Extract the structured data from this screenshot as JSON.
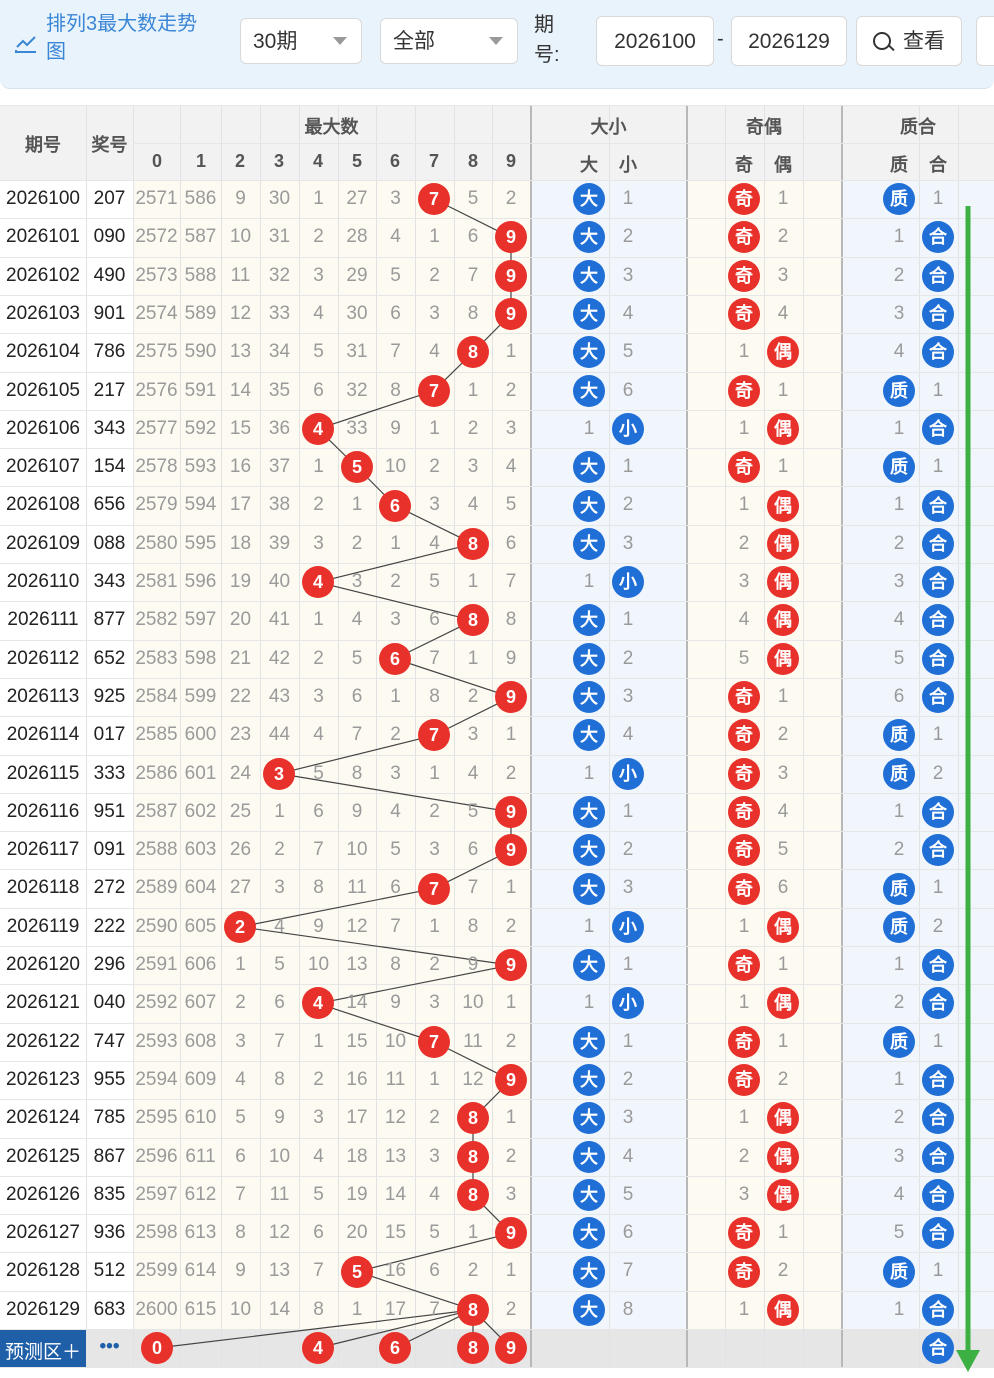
{
  "toolbar": {
    "title": "排列3最大数走势图",
    "period_select": "30期",
    "type_select": "全部",
    "period_label": "期号:",
    "from": "2026100",
    "dash": "-",
    "to": "2026129",
    "query": "查看"
  },
  "headers": {
    "period": "期号",
    "award": "奖号",
    "max_group": "最大数",
    "size_group": "大小",
    "odd_group": "奇偶",
    "prime_group": "质合",
    "digits": [
      "0",
      "1",
      "2",
      "3",
      "4",
      "5",
      "6",
      "7",
      "8",
      "9"
    ],
    "size": [
      "大",
      "小"
    ],
    "odd": [
      "奇",
      "偶"
    ],
    "prime": [
      "质",
      "合"
    ]
  },
  "footer": {
    "label": "预测区＋",
    "more": "•••"
  },
  "labels": {
    "big": "大",
    "small": "小",
    "odd": "奇",
    "even": "偶",
    "prime": "质",
    "composite": "合"
  },
  "colors": {
    "red": "#e8312a",
    "blue": "#1f6fd6",
    "green": "#3cb043"
  },
  "rows": [
    {
      "p": "2026100",
      "a": "207",
      "max": 7,
      "miss": [
        "2571",
        "586",
        "9",
        "30",
        "1",
        "27",
        "3",
        null,
        "5",
        "2"
      ],
      "size": "big",
      "sm": "1",
      "odd": "odd",
      "om": "1",
      "prime": "prime",
      "pm": "1"
    },
    {
      "p": "2026101",
      "a": "090",
      "max": 9,
      "miss": [
        "2572",
        "587",
        "10",
        "31",
        "2",
        "28",
        "4",
        "1",
        "6",
        null
      ],
      "size": "big",
      "sm": "2",
      "odd": "odd",
      "om": "2",
      "prime": "composite",
      "pm": "1"
    },
    {
      "p": "2026102",
      "a": "490",
      "max": 9,
      "miss": [
        "2573",
        "588",
        "11",
        "32",
        "3",
        "29",
        "5",
        "2",
        "7",
        null
      ],
      "size": "big",
      "sm": "3",
      "odd": "odd",
      "om": "3",
      "prime": "composite",
      "pm": "2"
    },
    {
      "p": "2026103",
      "a": "901",
      "max": 9,
      "miss": [
        "2574",
        "589",
        "12",
        "33",
        "4",
        "30",
        "6",
        "3",
        "8",
        null
      ],
      "size": "big",
      "sm": "4",
      "odd": "odd",
      "om": "4",
      "prime": "composite",
      "pm": "3"
    },
    {
      "p": "2026104",
      "a": "786",
      "max": 8,
      "miss": [
        "2575",
        "590",
        "13",
        "34",
        "5",
        "31",
        "7",
        "4",
        null,
        "1"
      ],
      "size": "big",
      "sm": "5",
      "odd": "even",
      "om": "1",
      "prime": "composite",
      "pm": "4"
    },
    {
      "p": "2026105",
      "a": "217",
      "max": 7,
      "miss": [
        "2576",
        "591",
        "14",
        "35",
        "6",
        "32",
        "8",
        null,
        "1",
        "2"
      ],
      "size": "big",
      "sm": "6",
      "odd": "odd",
      "om": "1",
      "prime": "prime",
      "pm": "1"
    },
    {
      "p": "2026106",
      "a": "343",
      "max": 4,
      "miss": [
        "2577",
        "592",
        "15",
        "36",
        null,
        "33",
        "9",
        "1",
        "2",
        "3"
      ],
      "size": "small",
      "sm": "1",
      "odd": "even",
      "om": "1",
      "prime": "composite",
      "pm": "1"
    },
    {
      "p": "2026107",
      "a": "154",
      "max": 5,
      "miss": [
        "2578",
        "593",
        "16",
        "37",
        "1",
        null,
        "10",
        "2",
        "3",
        "4"
      ],
      "size": "big",
      "sm": "1",
      "odd": "odd",
      "om": "1",
      "prime": "prime",
      "pm": "1"
    },
    {
      "p": "2026108",
      "a": "656",
      "max": 6,
      "miss": [
        "2579",
        "594",
        "17",
        "38",
        "2",
        "1",
        null,
        "3",
        "4",
        "5"
      ],
      "size": "big",
      "sm": "2",
      "odd": "even",
      "om": "1",
      "prime": "composite",
      "pm": "1"
    },
    {
      "p": "2026109",
      "a": "088",
      "max": 8,
      "miss": [
        "2580",
        "595",
        "18",
        "39",
        "3",
        "2",
        "1",
        "4",
        null,
        "6"
      ],
      "size": "big",
      "sm": "3",
      "odd": "even",
      "om": "2",
      "prime": "composite",
      "pm": "2"
    },
    {
      "p": "2026110",
      "a": "343",
      "max": 4,
      "miss": [
        "2581",
        "596",
        "19",
        "40",
        null,
        "3",
        "2",
        "5",
        "1",
        "7"
      ],
      "size": "small",
      "sm": "1",
      "odd": "even",
      "om": "3",
      "prime": "composite",
      "pm": "3"
    },
    {
      "p": "2026111",
      "a": "877",
      "max": 8,
      "miss": [
        "2582",
        "597",
        "20",
        "41",
        "1",
        "4",
        "3",
        "6",
        null,
        "8"
      ],
      "size": "big",
      "sm": "1",
      "odd": "even",
      "om": "4",
      "prime": "composite",
      "pm": "4"
    },
    {
      "p": "2026112",
      "a": "652",
      "max": 6,
      "miss": [
        "2583",
        "598",
        "21",
        "42",
        "2",
        "5",
        null,
        "7",
        "1",
        "9"
      ],
      "size": "big",
      "sm": "2",
      "odd": "even",
      "om": "5",
      "prime": "composite",
      "pm": "5"
    },
    {
      "p": "2026113",
      "a": "925",
      "max": 9,
      "miss": [
        "2584",
        "599",
        "22",
        "43",
        "3",
        "6",
        "1",
        "8",
        "2",
        null
      ],
      "size": "big",
      "sm": "3",
      "odd": "odd",
      "om": "1",
      "prime": "composite",
      "pm": "6"
    },
    {
      "p": "2026114",
      "a": "017",
      "max": 7,
      "miss": [
        "2585",
        "600",
        "23",
        "44",
        "4",
        "7",
        "2",
        null,
        "3",
        "1"
      ],
      "size": "big",
      "sm": "4",
      "odd": "odd",
      "om": "2",
      "prime": "prime",
      "pm": "1"
    },
    {
      "p": "2026115",
      "a": "333",
      "max": 3,
      "miss": [
        "2586",
        "601",
        "24",
        null,
        "5",
        "8",
        "3",
        "1",
        "4",
        "2"
      ],
      "size": "small",
      "sm": "1",
      "odd": "odd",
      "om": "3",
      "prime": "prime",
      "pm": "2"
    },
    {
      "p": "2026116",
      "a": "951",
      "max": 9,
      "miss": [
        "2587",
        "602",
        "25",
        "1",
        "6",
        "9",
        "4",
        "2",
        "5",
        null
      ],
      "size": "big",
      "sm": "1",
      "odd": "odd",
      "om": "4",
      "prime": "composite",
      "pm": "1"
    },
    {
      "p": "2026117",
      "a": "091",
      "max": 9,
      "miss": [
        "2588",
        "603",
        "26",
        "2",
        "7",
        "10",
        "5",
        "3",
        "6",
        null
      ],
      "size": "big",
      "sm": "2",
      "odd": "odd",
      "om": "5",
      "prime": "composite",
      "pm": "2"
    },
    {
      "p": "2026118",
      "a": "272",
      "max": 7,
      "miss": [
        "2589",
        "604",
        "27",
        "3",
        "8",
        "11",
        "6",
        null,
        "7",
        "1"
      ],
      "size": "big",
      "sm": "3",
      "odd": "odd",
      "om": "6",
      "prime": "prime",
      "pm": "1"
    },
    {
      "p": "2026119",
      "a": "222",
      "max": 2,
      "miss": [
        "2590",
        "605",
        null,
        "4",
        "9",
        "12",
        "7",
        "1",
        "8",
        "2"
      ],
      "size": "small",
      "sm": "1",
      "odd": "even",
      "om": "1",
      "prime": "prime",
      "pm": "2"
    },
    {
      "p": "2026120",
      "a": "296",
      "max": 9,
      "miss": [
        "2591",
        "606",
        "1",
        "5",
        "10",
        "13",
        "8",
        "2",
        "9",
        null
      ],
      "size": "big",
      "sm": "1",
      "odd": "odd",
      "om": "1",
      "prime": "composite",
      "pm": "1"
    },
    {
      "p": "2026121",
      "a": "040",
      "max": 4,
      "miss": [
        "2592",
        "607",
        "2",
        "6",
        null,
        "14",
        "9",
        "3",
        "10",
        "1"
      ],
      "size": "small",
      "sm": "1",
      "odd": "even",
      "om": "1",
      "prime": "composite",
      "pm": "2"
    },
    {
      "p": "2026122",
      "a": "747",
      "max": 7,
      "miss": [
        "2593",
        "608",
        "3",
        "7",
        "1",
        "15",
        "10",
        null,
        "11",
        "2"
      ],
      "size": "big",
      "sm": "1",
      "odd": "odd",
      "om": "1",
      "prime": "prime",
      "pm": "1"
    },
    {
      "p": "2026123",
      "a": "955",
      "max": 9,
      "miss": [
        "2594",
        "609",
        "4",
        "8",
        "2",
        "16",
        "11",
        "1",
        "12",
        null
      ],
      "size": "big",
      "sm": "2",
      "odd": "odd",
      "om": "2",
      "prime": "composite",
      "pm": "1"
    },
    {
      "p": "2026124",
      "a": "785",
      "max": 8,
      "miss": [
        "2595",
        "610",
        "5",
        "9",
        "3",
        "17",
        "12",
        "2",
        null,
        "1"
      ],
      "size": "big",
      "sm": "3",
      "odd": "even",
      "om": "1",
      "prime": "composite",
      "pm": "2"
    },
    {
      "p": "2026125",
      "a": "867",
      "max": 8,
      "miss": [
        "2596",
        "611",
        "6",
        "10",
        "4",
        "18",
        "13",
        "3",
        null,
        "2"
      ],
      "size": "big",
      "sm": "4",
      "odd": "even",
      "om": "2",
      "prime": "composite",
      "pm": "3"
    },
    {
      "p": "2026126",
      "a": "835",
      "max": 8,
      "miss": [
        "2597",
        "612",
        "7",
        "11",
        "5",
        "19",
        "14",
        "4",
        null,
        "3"
      ],
      "size": "big",
      "sm": "5",
      "odd": "even",
      "om": "3",
      "prime": "composite",
      "pm": "4"
    },
    {
      "p": "2026127",
      "a": "936",
      "max": 9,
      "miss": [
        "2598",
        "613",
        "8",
        "12",
        "6",
        "20",
        "15",
        "5",
        "1",
        null
      ],
      "size": "big",
      "sm": "6",
      "odd": "odd",
      "om": "1",
      "prime": "composite",
      "pm": "5"
    },
    {
      "p": "2026128",
      "a": "512",
      "max": 5,
      "miss": [
        "2599",
        "614",
        "9",
        "13",
        "7",
        null,
        "16",
        "6",
        "2",
        "1"
      ],
      "size": "big",
      "sm": "7",
      "odd": "odd",
      "om": "2",
      "prime": "prime",
      "pm": "1"
    },
    {
      "p": "2026129",
      "a": "683",
      "max": 8,
      "miss": [
        "2600",
        "615",
        "10",
        "14",
        "8",
        "1",
        "17",
        "7",
        null,
        "2"
      ],
      "size": "big",
      "sm": "8",
      "odd": "even",
      "om": "1",
      "prime": "composite",
      "pm": "1"
    }
  ],
  "prediction": {
    "digits": [
      0,
      4,
      6,
      8,
      9
    ],
    "prime_pick": "composite"
  }
}
